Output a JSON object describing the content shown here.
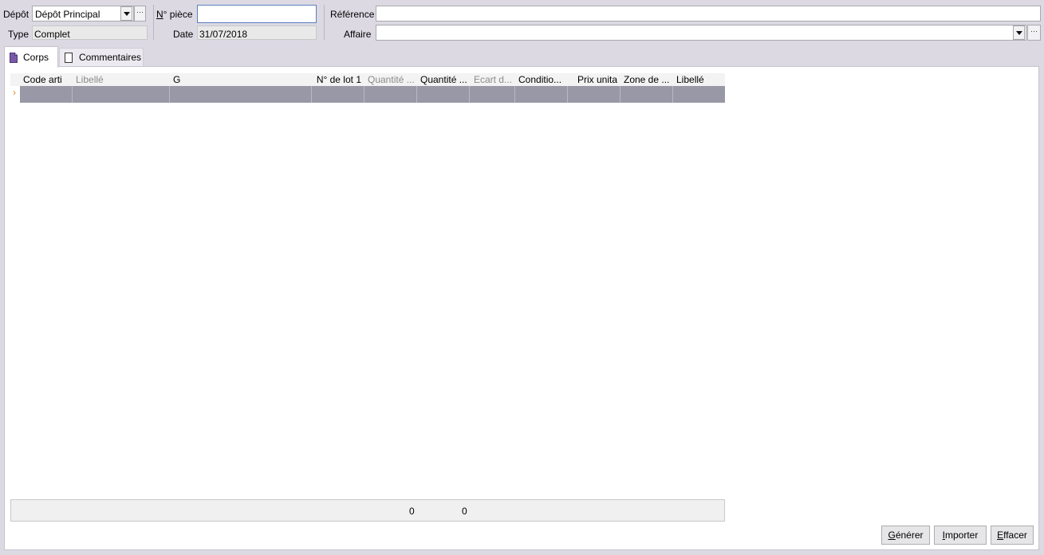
{
  "header": {
    "depot_label": "Dépôt",
    "depot_value": "Dépôt Principal",
    "type_label": "Type",
    "type_value": "Complet",
    "npiece_label": "N° pièce",
    "npiece_value": "",
    "date_label": "Date",
    "date_value": "31/07/2018",
    "reference_label": "Référence",
    "reference_value": "",
    "affaire_label": "Affaire",
    "affaire_value": ""
  },
  "tabs": [
    {
      "label": "Corps",
      "icon": "document-icon",
      "active": true
    },
    {
      "label": "Commentaires",
      "icon": "page-icon",
      "active": false
    }
  ],
  "grid": {
    "columns": [
      {
        "label": "Code arti",
        "dim": false
      },
      {
        "label": "Libellé",
        "dim": true
      },
      {
        "label": "G",
        "dim": false
      },
      {
        "label": "N° de lot 1",
        "dim": false
      },
      {
        "label": "Quantité ...",
        "dim": true
      },
      {
        "label": "Quantité ...",
        "dim": false
      },
      {
        "label": "Ecart d...",
        "dim": true
      },
      {
        "label": "Conditio...",
        "dim": false
      },
      {
        "label": "Prix unita",
        "dim": false
      },
      {
        "label": "Zone de ...",
        "dim": false
      },
      {
        "label": "Libellé",
        "dim": false
      }
    ],
    "row_marker": "›",
    "totals": [
      "0",
      "0"
    ]
  },
  "buttons": {
    "generer": "Générer",
    "importer": "Importer",
    "effacer": "Effacer"
  },
  "colors": {
    "window_bg": "#dcd9e3",
    "selected_row": "#9998a6",
    "focus_border": "#5b7fbf"
  }
}
